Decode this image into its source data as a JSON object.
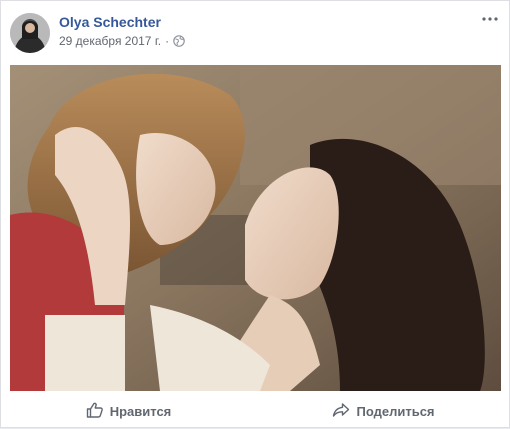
{
  "post": {
    "author": "Olya Schechter",
    "date": "29 декабря 2017 г.",
    "separator": "·",
    "privacy_icon": "globe-icon",
    "menu_icon": "more-options-icon",
    "photo_alt": "Мама и дочь"
  },
  "actions": {
    "like_label": "Нравится",
    "like_icon": "thumbs-up-icon",
    "share_label": "Поделиться",
    "share_icon": "share-arrow-icon"
  },
  "colors": {
    "author_link": "#365899",
    "meta_text": "#616770",
    "border": "#dddfe2"
  }
}
